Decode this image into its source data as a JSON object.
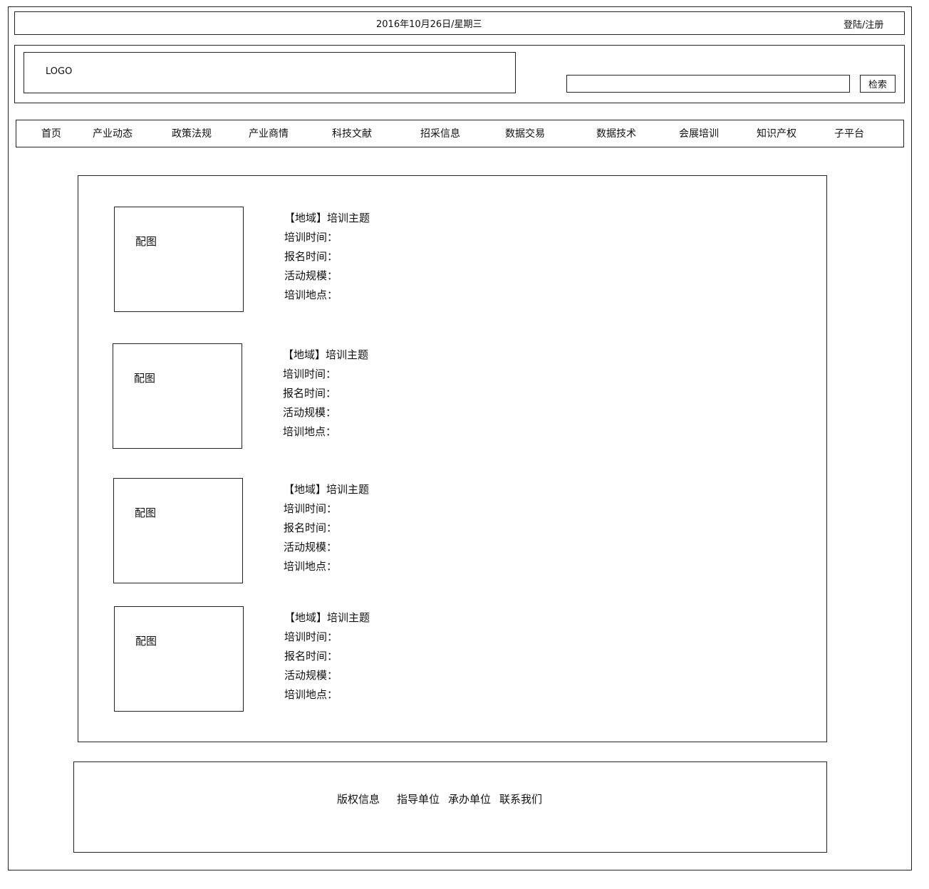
{
  "topbar": {
    "date": "2016年10月26日/星期三",
    "login": "登陆/注册"
  },
  "header": {
    "logo": "LOGO",
    "search_value": "",
    "search_button": "检索"
  },
  "nav": [
    "首页",
    "产业动态",
    "政策法规",
    "产业商情",
    "科技文献",
    "招采信息",
    "数据交易",
    "数据技术",
    "会展培训",
    "知识产权",
    "子平台"
  ],
  "listings": [
    {
      "image_label": "配图",
      "region": "【地域】",
      "topic": "培训主题",
      "time_label": "培训时间：",
      "signup_label": "报名时间：",
      "scale_label": "活动规模：",
      "location_label": "培训地点："
    },
    {
      "image_label": "配图",
      "region": "【地域】",
      "topic": "培训主题",
      "time_label": "培训时间：",
      "signup_label": "报名时间：",
      "scale_label": "活动规模：",
      "location_label": "培训地点："
    },
    {
      "image_label": "配图",
      "region": "【地域】",
      "topic": "培训主题",
      "time_label": "培训时间：",
      "signup_label": "报名时间：",
      "scale_label": "活动规模：",
      "location_label": "培训地点："
    },
    {
      "image_label": "配图",
      "region": "【地域】",
      "topic": "培训主题",
      "time_label": "培训时间：",
      "signup_label": "报名时间：",
      "scale_label": "活动规模：",
      "location_label": "培训地点："
    }
  ],
  "footer": {
    "copyright": "版权信息",
    "guide": "指导单位",
    "organizer": "承办单位",
    "contact": "联系我们"
  }
}
